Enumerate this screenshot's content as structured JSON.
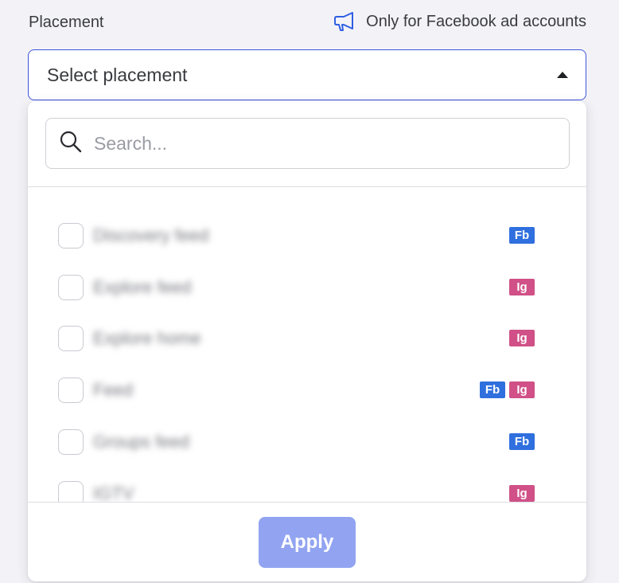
{
  "field": {
    "label": "Placement",
    "notice": "Only for Facebook ad accounts",
    "notice_icon": "megaphone-icon"
  },
  "select": {
    "value": "Select placement"
  },
  "search": {
    "value": "",
    "placeholder": "Search..."
  },
  "options": [
    {
      "label": "Discovery feed",
      "checked": false,
      "platforms": [
        "Fb"
      ]
    },
    {
      "label": "Explore feed",
      "checked": false,
      "platforms": [
        "Ig"
      ]
    },
    {
      "label": "Explore home",
      "checked": false,
      "platforms": [
        "Ig"
      ]
    },
    {
      "label": "Feed",
      "checked": false,
      "platforms": [
        "Fb",
        "Ig"
      ]
    },
    {
      "label": "Groups feed",
      "checked": false,
      "platforms": [
        "Fb"
      ]
    },
    {
      "label": "IGTV",
      "checked": false,
      "platforms": [
        "Ig"
      ]
    }
  ],
  "apply_label": "Apply",
  "colors": {
    "accent": "#3d55d9",
    "apply_disabled": "#92a4f1",
    "fb_badge": "#2f6fde",
    "ig_badge": "#d05087"
  }
}
